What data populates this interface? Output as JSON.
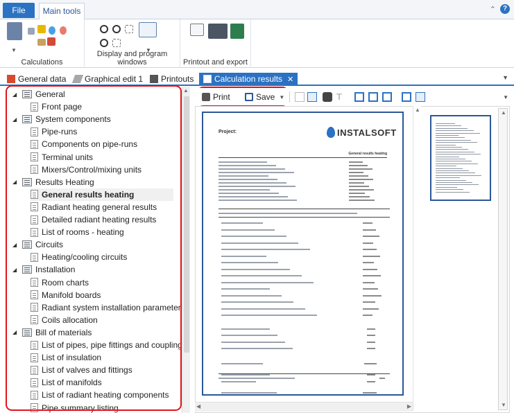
{
  "ribbon": {
    "file_tab": "File",
    "main_tab": "Main tools",
    "groups": {
      "calculations": "Calculations",
      "display": "Display and program windows",
      "printout": "Printout and export"
    }
  },
  "doc_tabs": [
    {
      "label": "General data"
    },
    {
      "label": "Graphical edit 1"
    },
    {
      "label": "Printouts"
    },
    {
      "label": "Calculation results"
    }
  ],
  "doc_tab_close": "✕",
  "tree": [
    {
      "label": "General",
      "level": 0
    },
    {
      "label": "Front page",
      "level": 1
    },
    {
      "label": "System components",
      "level": 0
    },
    {
      "label": "Pipe-runs",
      "level": 1
    },
    {
      "label": "Components on pipe-runs",
      "level": 1
    },
    {
      "label": "Terminal units",
      "level": 1
    },
    {
      "label": "Mixers/Control/mixing units",
      "level": 1
    },
    {
      "label": "Results Heating",
      "level": 0
    },
    {
      "label": "General results heating",
      "level": 1,
      "selected": true
    },
    {
      "label": "Radiant heating general results",
      "level": 1
    },
    {
      "label": "Detailed radiant heating results",
      "level": 1
    },
    {
      "label": "List of rooms - heating",
      "level": 1
    },
    {
      "label": "Circuits",
      "level": 0
    },
    {
      "label": "Heating/cooling circuits",
      "level": 1
    },
    {
      "label": "Installation",
      "level": 0
    },
    {
      "label": "Room charts",
      "level": 1
    },
    {
      "label": "Manifold boards",
      "level": 1
    },
    {
      "label": "Radiant system installation parameters",
      "level": 1
    },
    {
      "label": "Coils allocation",
      "level": 1
    },
    {
      "label": "Bill of materials",
      "level": 0
    },
    {
      "label": "List of pipes, pipe fittings and couplings",
      "level": 1
    },
    {
      "label": "List of insulation",
      "level": 1
    },
    {
      "label": "List of valves and fittings",
      "level": 1
    },
    {
      "label": "List of manifolds",
      "level": 1
    },
    {
      "label": "List of radiant heating components",
      "level": 1
    },
    {
      "label": "Pipe summary listing",
      "level": 1
    }
  ],
  "toolbar": {
    "print_label": "Print",
    "save_label": "Save"
  },
  "preview": {
    "project_label": "Project:",
    "logo_text": "INSTALSOFT",
    "report_title": "General results heating"
  },
  "colors": {
    "accent_blue": "#2b72c2",
    "highlight_red": "#e0141e",
    "page_border": "#2b5797"
  }
}
